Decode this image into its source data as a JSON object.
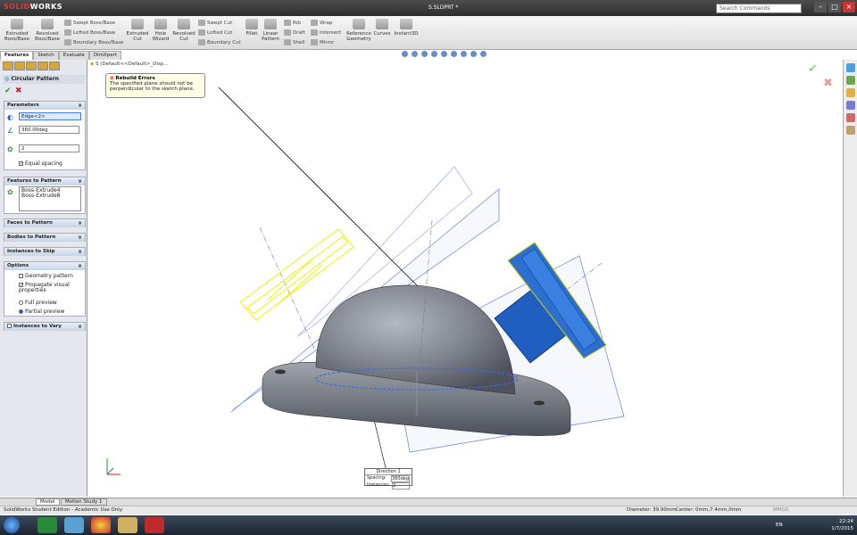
{
  "titlebar": {
    "logo_bold": "SOLID",
    "logo_rest": "WORKS",
    "filename": "S.SLDPRT *",
    "search_placeholder": "Search Commands"
  },
  "ribbon": {
    "big_buttons": [
      {
        "label": "Extruded Boss/Base"
      },
      {
        "label": "Revolved Boss/Base"
      },
      {
        "label": "Extruded Cut"
      },
      {
        "label": "Hole Wizard"
      },
      {
        "label": "Revolved Cut"
      },
      {
        "label": "Fillet"
      },
      {
        "label": "Linear Pattern"
      },
      {
        "label": "Reference Geometry"
      },
      {
        "label": "Curves"
      },
      {
        "label": "Instant3D"
      }
    ],
    "small_buttons": [
      {
        "label": "Swept Boss/Base"
      },
      {
        "label": "Lofted Boss/Base"
      },
      {
        "label": "Boundary Boss/Base"
      },
      {
        "label": "Swept Cut"
      },
      {
        "label": "Lofted Cut"
      },
      {
        "label": "Boundary Cut"
      },
      {
        "label": "Rib"
      },
      {
        "label": "Draft"
      },
      {
        "label": "Shell"
      },
      {
        "label": "Wrap"
      },
      {
        "label": "Intersect"
      },
      {
        "label": "Mirror"
      }
    ]
  },
  "command_tabs": [
    "Features",
    "Sketch",
    "Evaluate",
    "DimXpert"
  ],
  "feature_tree_node": "S (Default<<Default>_Disp...",
  "property_manager": {
    "title": "Circular Pattern",
    "parameters": {
      "header": "Parameters",
      "axis_value": "Edge<2>",
      "angle_value": "360.00deg",
      "instances_value": "2",
      "equal_spacing": "Equal spacing"
    },
    "features_to_pattern": {
      "header": "Features to Pattern",
      "items": [
        "Boss-Extrude4",
        "Boss-Extrude8"
      ]
    },
    "collapsed_sections": [
      "Faces to Pattern",
      "Bodies to Pattern",
      "Instances to Skip"
    ],
    "options": {
      "header": "Options",
      "geometry_pattern": "Geometry pattern",
      "propagate": "Propagate visual properties",
      "full_preview": "Full preview",
      "partial_preview": "Partial preview"
    },
    "instances_to_vary": "Instances to Vary"
  },
  "rebuild_error": {
    "title": "Rebuild Errors",
    "message": "The specified plane should not be perpendicular to the sketch plane."
  },
  "direction_callout": {
    "title": "Direction 1",
    "spacing_label": "Spacing:",
    "spacing_value": "360deg",
    "instances_label": "Instances:",
    "instances_value": "2"
  },
  "bottom_tabs": [
    "Model",
    "Motion Study 1"
  ],
  "status": {
    "edition": "SolidWorks Student Edition - Academic Use Only",
    "diameter": "Diameter: 39.90mm",
    "center": "Center: 0mm,7.4mm,0mm",
    "units": "MMGS"
  },
  "tray": {
    "lang": "EN",
    "time": "22:24",
    "date": "1/7/2015"
  },
  "colors": {
    "accent_blue": "#1f5fbf",
    "preview_yellow": "#f2f200",
    "body_grey": "#7a7f8a"
  }
}
